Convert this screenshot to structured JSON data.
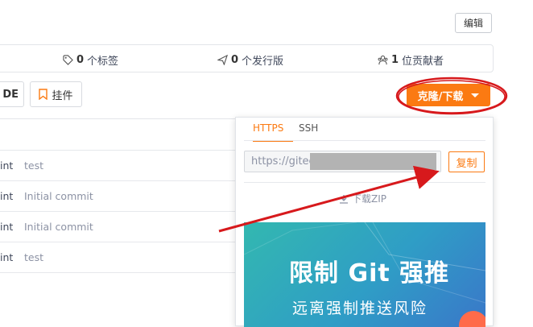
{
  "header": {
    "edit_label": "编辑"
  },
  "stats": {
    "tags": {
      "count": "0",
      "label": "个标签"
    },
    "releases": {
      "count": "0",
      "label": "个发行版"
    },
    "contributors": {
      "count": "1",
      "label": "位贡献者"
    }
  },
  "toolbar": {
    "ide_label": "DE",
    "plugin_label": "挂件",
    "clone_label": "克隆/下载"
  },
  "files": [
    {
      "col1": "int",
      "message": "test"
    },
    {
      "col1": "int",
      "message": "Initial commit"
    },
    {
      "col1": "int",
      "message": "Initial commit"
    },
    {
      "col1": "int",
      "message": "test"
    }
  ],
  "clone_panel": {
    "tabs": [
      "HTTPS",
      "SSH"
    ],
    "active_tab": "HTTPS",
    "url_value": "https://gitee",
    "copy_label": "复制",
    "download_label": "下载ZIP",
    "banner_title": "限制 Git 强推",
    "banner_subtitle": "远离强制推送风险"
  },
  "colors": {
    "accent": "#fb7a12",
    "annotation": "#d7191c",
    "banner_start": "#33b8b0",
    "banner_end": "#3a77c9"
  },
  "icons": [
    "tag-icon",
    "send-icon",
    "contributors-icon",
    "bookmark-icon",
    "caret-down-icon",
    "download-icon"
  ]
}
